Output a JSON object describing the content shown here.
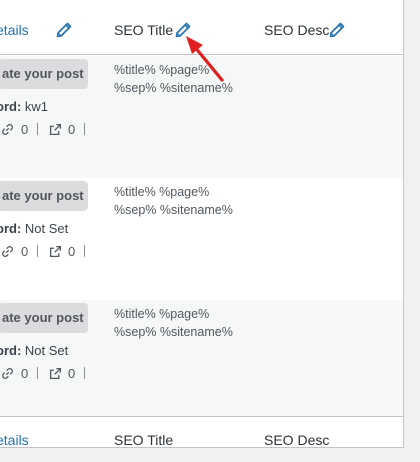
{
  "columns": {
    "details": "etails",
    "seo_title": "SEO Title",
    "seo_desc": "SEO Desc"
  },
  "footer": {
    "details": "etails",
    "seo_title": "SEO Title",
    "seo_desc": "SEO Desc"
  },
  "rows": [
    {
      "button_label": "ate your post",
      "keyword_label": "ord:",
      "keyword_value": "kw1",
      "links_count": "0",
      "external_count": "0",
      "seo_title_line1": "%title% %page%",
      "seo_title_line2": "%sep% %sitename%"
    },
    {
      "button_label": "ate your post",
      "keyword_label": "ord:",
      "keyword_value": "Not Set",
      "links_count": "0",
      "external_count": "0",
      "seo_title_line1": "%title% %page%",
      "seo_title_line2": "%sep% %sitename%"
    },
    {
      "button_label": "ate your post",
      "keyword_label": "ord:",
      "keyword_value": "Not Set",
      "links_count": "0",
      "external_count": "0",
      "seo_title_line1": "%title% %page%",
      "seo_title_line2": "%sep% %sitename%"
    }
  ],
  "icons": {
    "edit": "pencil-icon",
    "link": "link-icon",
    "external": "external-link-icon"
  },
  "colors": {
    "link_blue": "#2271b1",
    "annotation_arrow": "#e02020"
  }
}
